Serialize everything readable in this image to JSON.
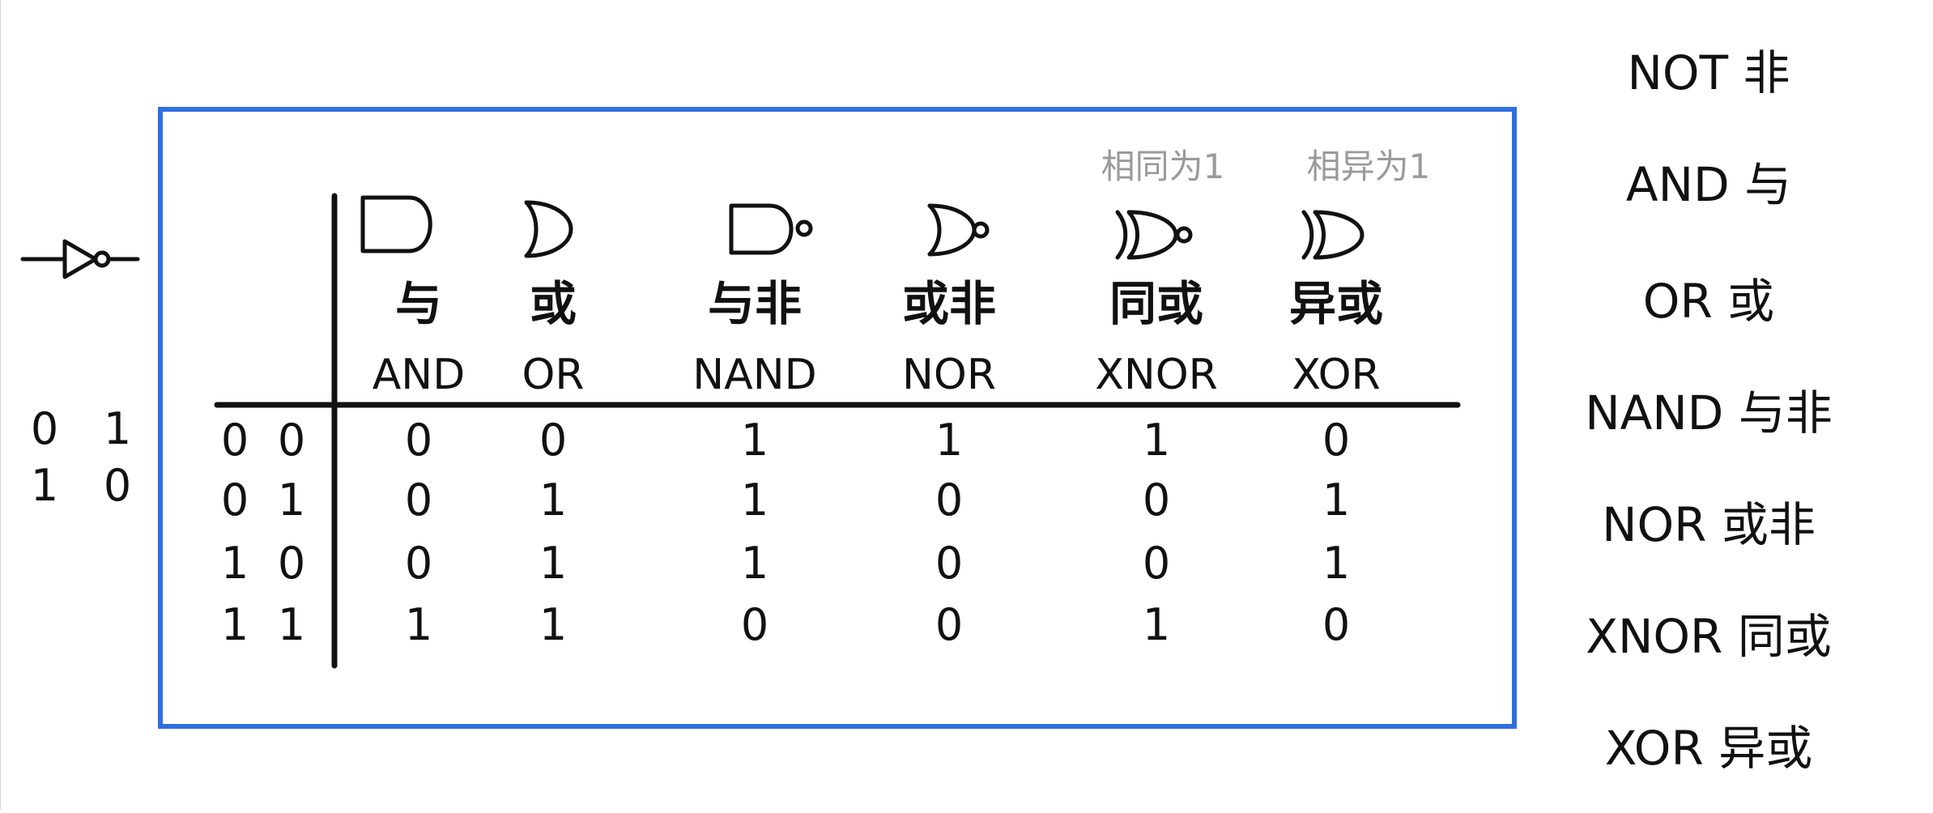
{
  "not_gate": {
    "icon": "not-gate-icon",
    "truth": [
      [
        "0",
        "1"
      ],
      [
        "1",
        "0"
      ]
    ]
  },
  "table": {
    "border_color": "#2f6fe0",
    "notes": [
      "相同为1",
      "相异为1"
    ],
    "columns": [
      {
        "zh": "与",
        "en": "AND",
        "icon": "and-gate-icon"
      },
      {
        "zh": "或",
        "en": "OR",
        "icon": "or-gate-icon"
      },
      {
        "zh": "与非",
        "en": "NAND",
        "icon": "nand-gate-icon"
      },
      {
        "zh": "或非",
        "en": "NOR",
        "icon": "nor-gate-icon"
      },
      {
        "zh": "同或",
        "en": "XNOR",
        "icon": "xnor-gate-icon"
      },
      {
        "zh": "异或",
        "en": "XOR",
        "icon": "xor-gate-icon"
      }
    ],
    "rows": [
      {
        "inputs": [
          "0",
          "0"
        ],
        "outputs": [
          "0",
          "0",
          "1",
          "1",
          "1",
          "0"
        ]
      },
      {
        "inputs": [
          "0",
          "1"
        ],
        "outputs": [
          "0",
          "1",
          "1",
          "0",
          "0",
          "1"
        ]
      },
      {
        "inputs": [
          "1",
          "0"
        ],
        "outputs": [
          "0",
          "1",
          "1",
          "0",
          "0",
          "1"
        ]
      },
      {
        "inputs": [
          "1",
          "1"
        ],
        "outputs": [
          "1",
          "1",
          "0",
          "0",
          "1",
          "0"
        ]
      }
    ]
  },
  "legend": [
    {
      "text": "NOT 非"
    },
    {
      "text": "AND 与"
    },
    {
      "text": "OR 或"
    },
    {
      "text": "NAND 与非"
    },
    {
      "text": "NOR 或非"
    },
    {
      "text": "XNOR 同或"
    },
    {
      "text": "XOR 异或"
    }
  ]
}
